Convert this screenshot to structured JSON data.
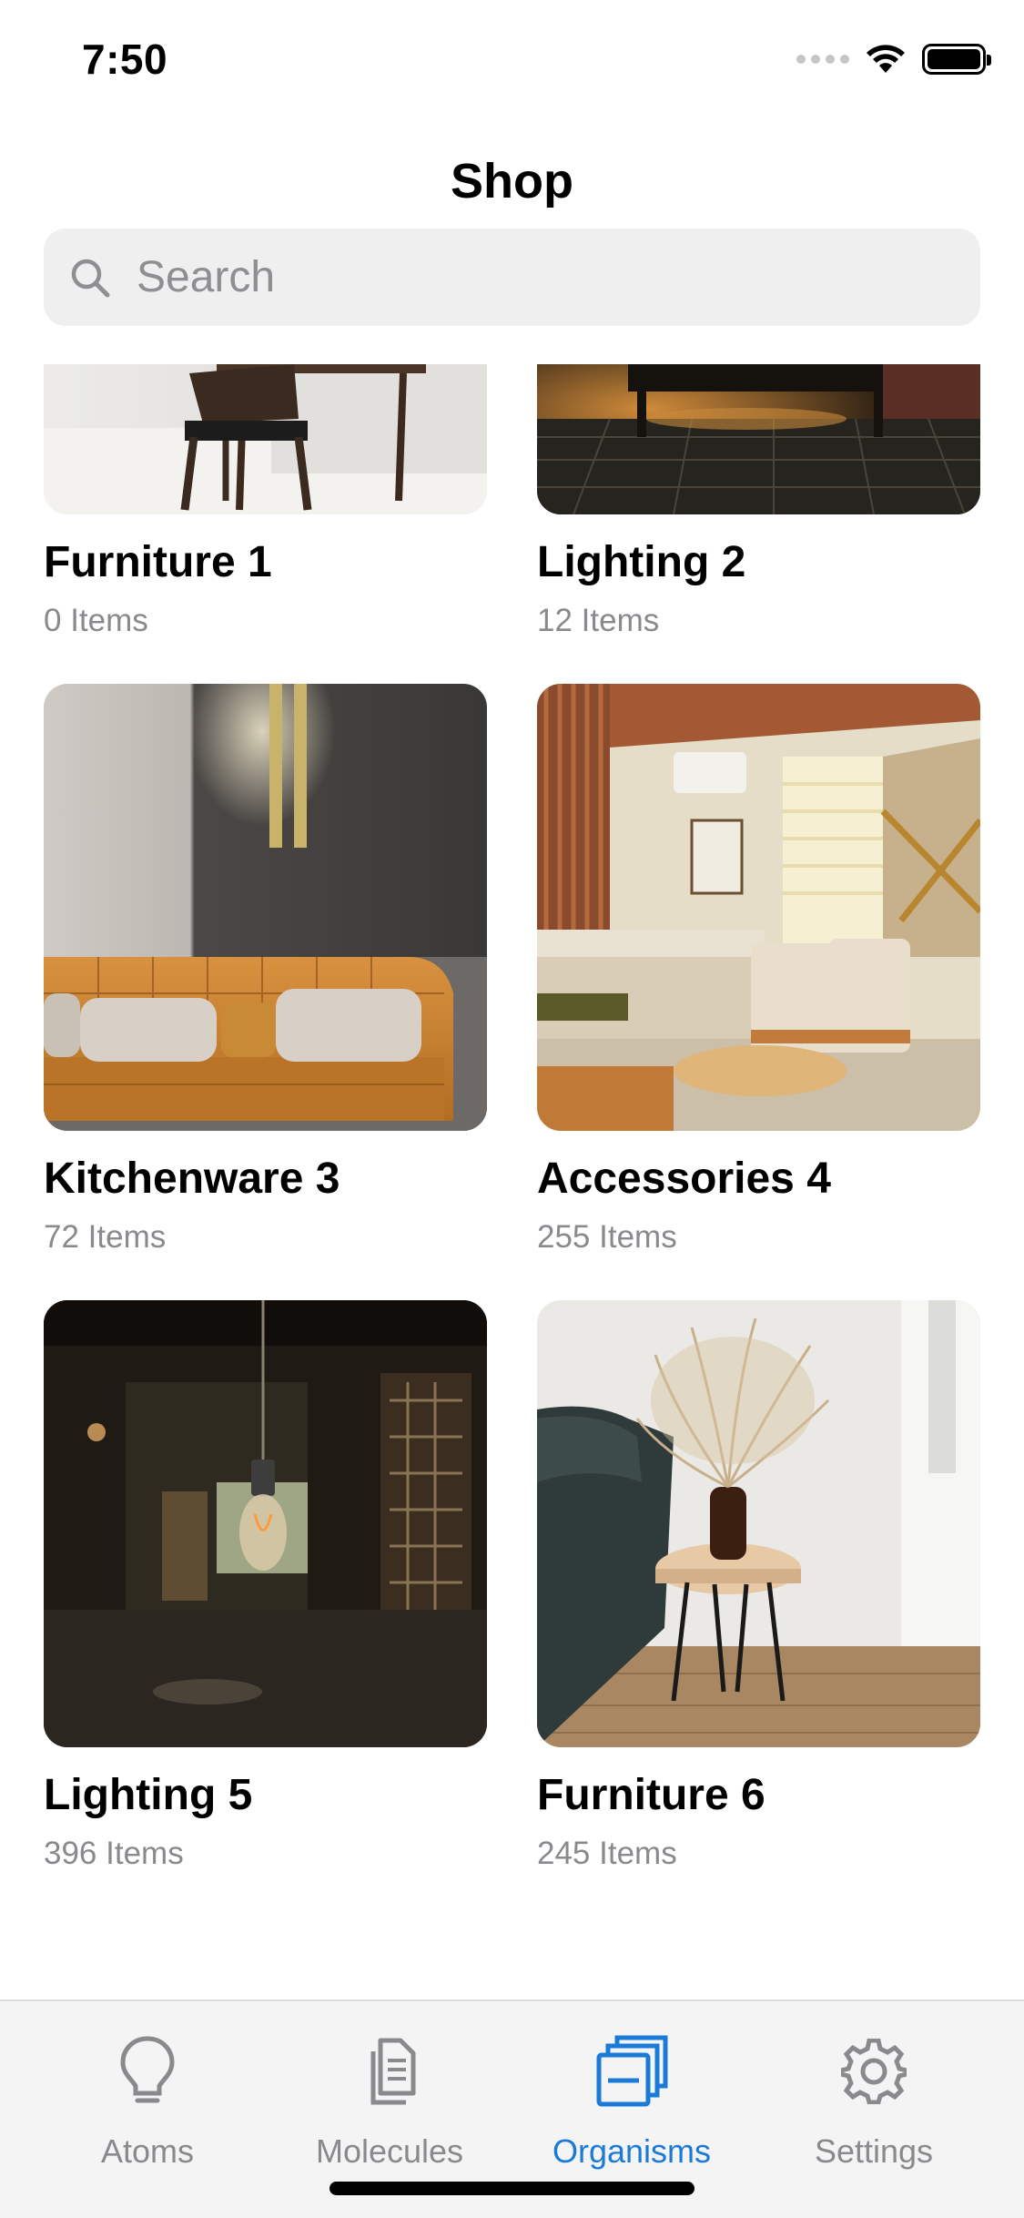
{
  "status_bar": {
    "time": "7:50"
  },
  "header": {
    "title": "Shop"
  },
  "search": {
    "placeholder": "Search",
    "value": ""
  },
  "categories": [
    {
      "title": "Furniture 1",
      "count": "0 Items"
    },
    {
      "title": "Lighting 2",
      "count": "12 Items"
    },
    {
      "title": "Kitchenware 3",
      "count": "72 Items"
    },
    {
      "title": "Accessories 4",
      "count": "255 Items"
    },
    {
      "title": "Lighting 5",
      "count": "396 Items"
    },
    {
      "title": "Furniture 6",
      "count": "245 Items"
    }
  ],
  "tab_bar": {
    "active_color": "#1a7ad8",
    "inactive_color": "#8a8a8e",
    "tabs": [
      {
        "label": "Atoms",
        "icon": "lightbulb-icon"
      },
      {
        "label": "Molecules",
        "icon": "document-icon"
      },
      {
        "label": "Organisms",
        "icon": "stacked-squares-icon",
        "active": true
      },
      {
        "label": "Settings",
        "icon": "gear-icon"
      }
    ]
  }
}
